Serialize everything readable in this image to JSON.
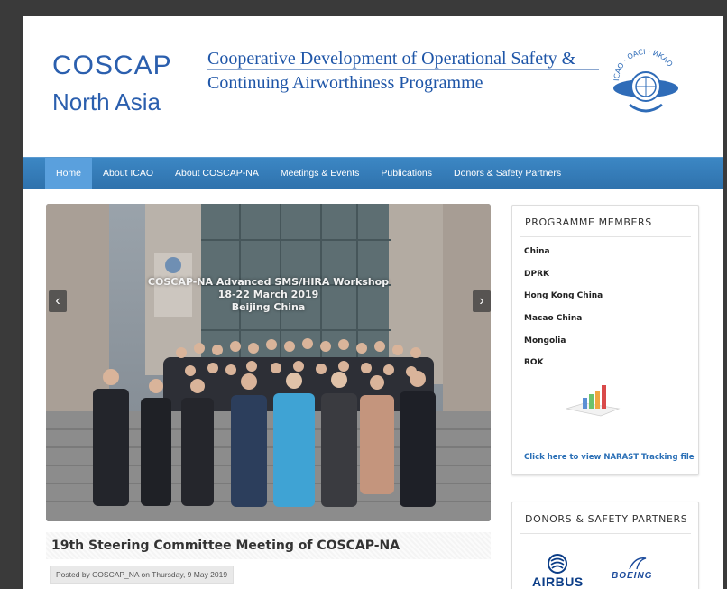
{
  "header": {
    "brand_name": "COSCAP",
    "brand_region": "North Asia",
    "programme_line1": "Cooperative Development of Operational Safety &",
    "programme_line2": "Continuing Airworthiness Programme",
    "logo_icon": "icao-emblem-logo",
    "logo_lettering": "ICAO · OACI · ИКАО"
  },
  "nav": {
    "items": [
      "Home",
      "About ICAO",
      "About COSCAP-NA",
      "Meetings & Events",
      "Publications",
      "Donors & Safety Partners"
    ],
    "active": "Home"
  },
  "slider": {
    "caption_line1": "COSCAP-NA Advanced SMS/HIRA Workshop",
    "caption_line2": "18-22 March 2019",
    "caption_line3": "Beijing China",
    "prev_icon": "chevron-left-icon",
    "next_icon": "chevron-right-icon"
  },
  "post": {
    "title": "19th Steering Committee Meeting of COSCAP-NA",
    "meta": "Posted by COSCAP_NA on Thursday, 9 May 2019"
  },
  "sidebar": {
    "members_title": "PROGRAMME MEMBERS",
    "members": [
      "China",
      "DPRK",
      "Hong Kong China",
      "Macao China",
      "Mongolia",
      "ROK"
    ],
    "chart_icon": "bar-chart-icon",
    "narast_link": "Click here to view NARAST Tracking file",
    "donors_title": "DONORS & SAFETY PARTNERS",
    "donors": [
      "AIRBUS",
      "BOEING"
    ]
  },
  "colors": {
    "brand_blue": "#2b5fae",
    "nav_blue": "#3478b6",
    "nav_active": "#5aa0dd",
    "link_blue": "#2a6fb6"
  }
}
